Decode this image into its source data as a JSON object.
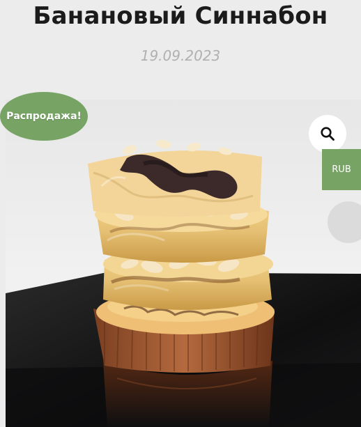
{
  "product": {
    "title": "Банановый Синнабон",
    "date": "19.09.2023",
    "sale_badge": "Распродажа!",
    "currency": "RUB"
  },
  "icons": {
    "zoom": "search-icon"
  },
  "colors": {
    "accent": "#77a464",
    "background": "#ececec",
    "title": "#1b1b1b",
    "date": "#b0b0b0"
  }
}
